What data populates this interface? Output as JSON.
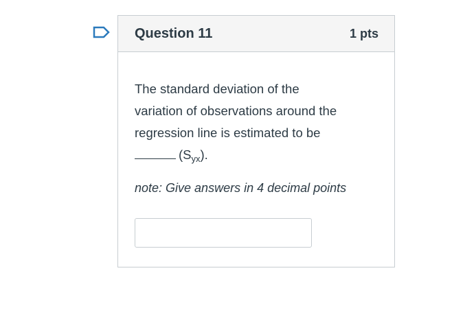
{
  "question": {
    "title": "Question 11",
    "points": "1 pts",
    "text_line1": "The standard deviation of the",
    "text_line2": "variation of observations around the",
    "text_line3": "regression line is estimated to be",
    "paren_open": "(S",
    "subscript": "yx",
    "paren_close": ").",
    "note": "note: Give answers in 4 decimal points",
    "answer_value": "",
    "answer_placeholder": ""
  },
  "icons": {
    "flag": "flag-icon"
  },
  "colors": {
    "flag_stroke": "#2b7abc",
    "header_bg": "#f5f5f5",
    "border": "#c7cdd1",
    "text": "#2d3b45"
  }
}
